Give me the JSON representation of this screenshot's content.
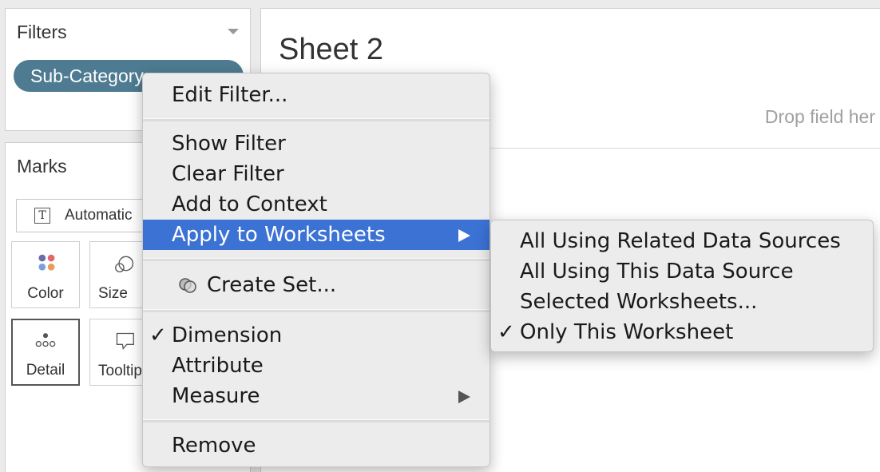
{
  "filters": {
    "title": "Filters",
    "pill_label": "Sub-Category"
  },
  "marks": {
    "title": "Marks",
    "mark_type": "Automatic",
    "buttons": {
      "color": "Color",
      "size": "Size",
      "detail": "Detail",
      "tooltip": "Tooltip"
    }
  },
  "sheet": {
    "title": "Sheet 2",
    "drop_hint": "Drop field her"
  },
  "context_menu": {
    "items": {
      "edit_filter": "Edit Filter...",
      "show_filter": "Show Filter",
      "clear_filter": "Clear Filter",
      "add_to_context": "Add to Context",
      "apply_to_worksheets": "Apply to Worksheets",
      "create_set": "Create Set...",
      "dimension": "Dimension",
      "attribute": "Attribute",
      "measure": "Measure",
      "remove": "Remove"
    },
    "checked_item": "Dimension",
    "highlighted_item": "Apply to Worksheets"
  },
  "submenu": {
    "items": {
      "related": "All Using Related Data Sources",
      "this_source": "All Using This Data Source",
      "selected": "Selected Worksheets...",
      "only_this": "Only This Worksheet"
    },
    "checked_item": "Only This Worksheet"
  },
  "colors": {
    "pill": "#4e7b91",
    "highlight": "#3b72d4",
    "menu_bg": "#ececec"
  },
  "check_glyph": "✓"
}
